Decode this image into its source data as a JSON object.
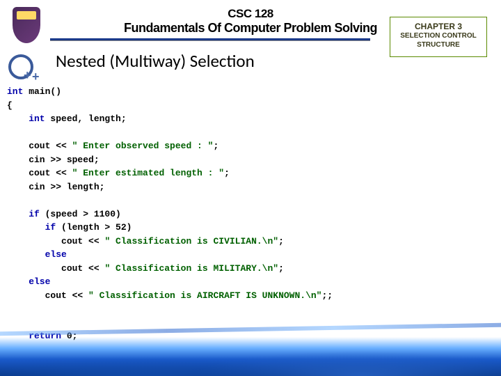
{
  "header": {
    "course_code": "CSC 128",
    "course_title": "Fundamentals Of Computer Problem Solving",
    "slide_title": "Nested (Multiway) Selection"
  },
  "chapter": {
    "line1": "CHAPTER 3",
    "line2": "SELECTION CONTROL STRUCTURE"
  },
  "code": {
    "l1a": "int",
    "l1b": " main()",
    "l2": "{",
    "l3a": "    int",
    "l3b": " speed, length;",
    "l4a": "    cout << ",
    "l4b": "\" Enter observed speed : \"",
    "l4c": ";",
    "l5": "    cin >> speed;",
    "l6a": "    cout << ",
    "l6b": "\" Enter estimated length : \"",
    "l6c": ";",
    "l7": "    cin >> length;",
    "l8a": "    if",
    "l8b": " (speed > 1100)",
    "l9a": "       if",
    "l9b": " (length > 52)",
    "l10a": "          cout << ",
    "l10b": "\" Classification is CIVILIAN.\\n\"",
    "l10c": ";",
    "l11a": "       else",
    "l12a": "          cout << ",
    "l12b": "\" Classification is MILITARY.\\n\"",
    "l12c": ";",
    "l13a": "    else",
    "l14a": "       cout << ",
    "l14b": "\" Classification is AIRCRAFT IS UNKNOWN.\\n\"",
    "l14c": ";;",
    "l15a": "    return",
    "l15b": " 0;",
    "l16": "}"
  }
}
